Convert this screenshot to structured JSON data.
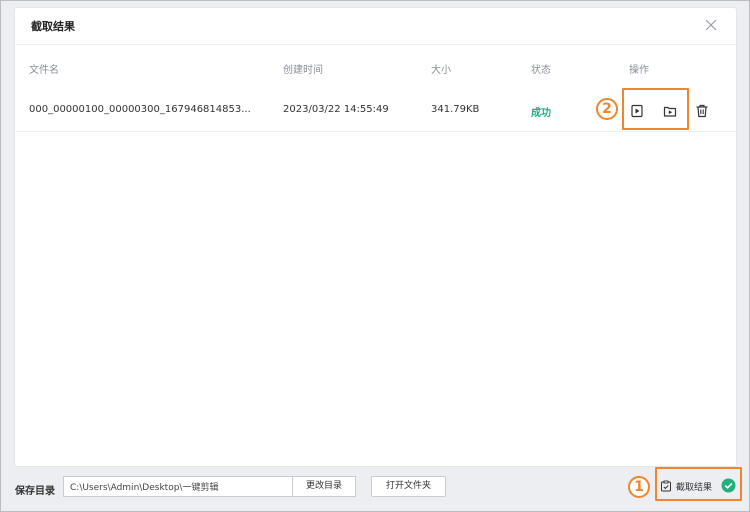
{
  "dialog": {
    "title": "截取结果",
    "columns": [
      "文件名",
      "创建时间",
      "大小",
      "状态",
      "操作"
    ],
    "rows": [
      {
        "filename": "000_00000100_00000300_167946814853...",
        "created": "2023/03/22 14:55:49",
        "size": "341.79KB",
        "status": "成功"
      }
    ]
  },
  "footer": {
    "save_label": "保存目录",
    "path_value": "C:\\Users\\Admin\\Desktop\\一键剪辑",
    "change_dir_label": "更改目录",
    "open_folder_label": "打开文件夹",
    "results_label": "截取结果"
  },
  "annotations": {
    "marker_1": "1",
    "marker_2": "2"
  },
  "colors": {
    "accent_orange": "#f0852d",
    "success_green": "#22b07d"
  }
}
